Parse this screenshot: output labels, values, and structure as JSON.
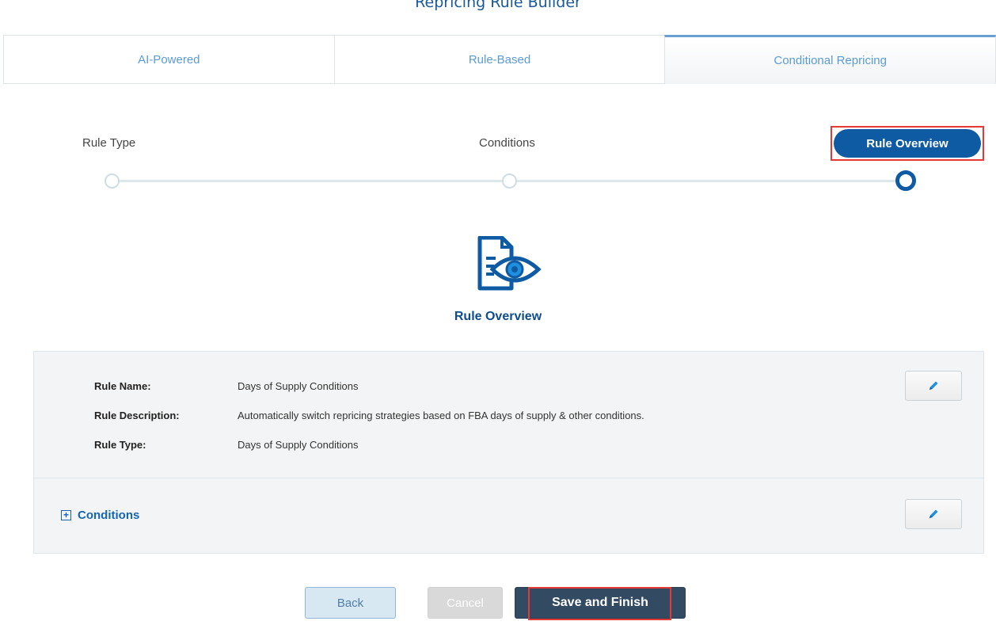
{
  "page": {
    "title": "Repricing Rule Builder"
  },
  "tabs": [
    {
      "label": "AI-Powered",
      "active": false
    },
    {
      "label": "Rule-Based",
      "active": false
    },
    {
      "label": "Conditional Repricing",
      "active": true
    }
  ],
  "stepper": {
    "steps": [
      {
        "label": "Rule Type",
        "state": "done"
      },
      {
        "label": "Conditions",
        "state": "done"
      },
      {
        "label": "Rule Overview",
        "state": "current"
      }
    ]
  },
  "overview": {
    "icon": "document-eye-icon",
    "title": "Rule Overview"
  },
  "details": {
    "rule_name_label": "Rule Name:",
    "rule_name_value": "Days of Supply Conditions",
    "rule_description_label": "Rule Description:",
    "rule_description_value": "Automatically switch repricing strategies based on FBA days of supply & other conditions.",
    "rule_type_label": "Rule Type:",
    "rule_type_value": "Days of Supply Conditions",
    "edit_icon": "pencil-icon"
  },
  "conditions": {
    "toggle_symbol": "+",
    "label": "Conditions",
    "edit_icon": "pencil-icon"
  },
  "footer": {
    "back_label": "Back",
    "cancel_label": "Cancel",
    "save_label": "Save and Finish"
  },
  "colors": {
    "primary": "#0e5aa3",
    "tab_text": "#5b9bd5",
    "save_button": "#334a63",
    "highlight": "#e53935"
  }
}
